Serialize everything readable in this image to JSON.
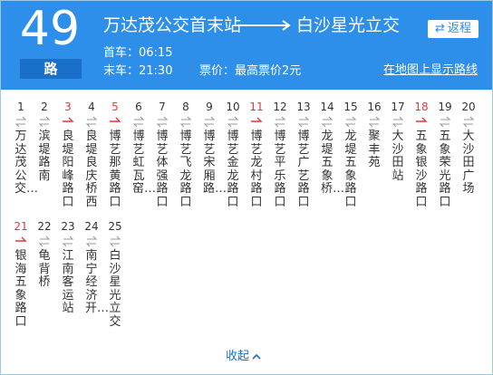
{
  "route": {
    "number": "49",
    "suffix": "路",
    "from": "万达茂公交首末站",
    "to": "白沙星光立交",
    "first_bus": "首车：06:15",
    "last_bus": "末车：21:30",
    "fare": "票价：最高票价2元",
    "reverse_label": "返程",
    "map_link": "在地图上显示路线",
    "collapse_label": "收起"
  },
  "colors": {
    "header": "#2e8fea",
    "badge": "#1a6fc9",
    "red": "#e3373a",
    "link": "#1a6fc9"
  },
  "stops": [
    {
      "num": "1",
      "name": "万达茂公交…",
      "dir": "both"
    },
    {
      "num": "2",
      "name": "滨堤路南",
      "dir": "both"
    },
    {
      "num": "3",
      "name": "良堤阳峰路口",
      "dir": "one"
    },
    {
      "num": "4",
      "name": "良堤良庆桥西",
      "dir": "both"
    },
    {
      "num": "5",
      "name": "博艺那黄路口",
      "dir": "one"
    },
    {
      "num": "6",
      "name": "博艺虹瓦窑…",
      "dir": "both"
    },
    {
      "num": "7",
      "name": "博艺体强路口",
      "dir": "both"
    },
    {
      "num": "8",
      "name": "博艺飞龙路口",
      "dir": "both"
    },
    {
      "num": "9",
      "name": "博艺宋厢路…",
      "dir": "both"
    },
    {
      "num": "10",
      "name": "博艺金龙路口",
      "dir": "both"
    },
    {
      "num": "11",
      "name": "博艺龙村路口",
      "dir": "one"
    },
    {
      "num": "12",
      "name": "博艺平乐路口",
      "dir": "both"
    },
    {
      "num": "13",
      "name": "博艺广艺路口",
      "dir": "both"
    },
    {
      "num": "14",
      "name": "龙堤五象桥…",
      "dir": "both"
    },
    {
      "num": "15",
      "name": "龙堤五象路口",
      "dir": "both"
    },
    {
      "num": "16",
      "name": "聚丰苑",
      "dir": "both"
    },
    {
      "num": "17",
      "name": "大沙田站",
      "dir": "both"
    },
    {
      "num": "18",
      "name": "五象银沙路口",
      "dir": "one"
    },
    {
      "num": "19",
      "name": "五象荣光路口",
      "dir": "both"
    },
    {
      "num": "20",
      "name": "大沙田广场",
      "dir": "both"
    },
    {
      "num": "21",
      "name": "银海五象路口",
      "dir": "one"
    },
    {
      "num": "22",
      "name": "龟背桥",
      "dir": "both"
    },
    {
      "num": "23",
      "name": "江南客运站",
      "dir": "both"
    },
    {
      "num": "24",
      "name": "南宁经济开…",
      "dir": "both"
    },
    {
      "num": "25",
      "name": "白沙星光立交",
      "dir": "both"
    }
  ]
}
